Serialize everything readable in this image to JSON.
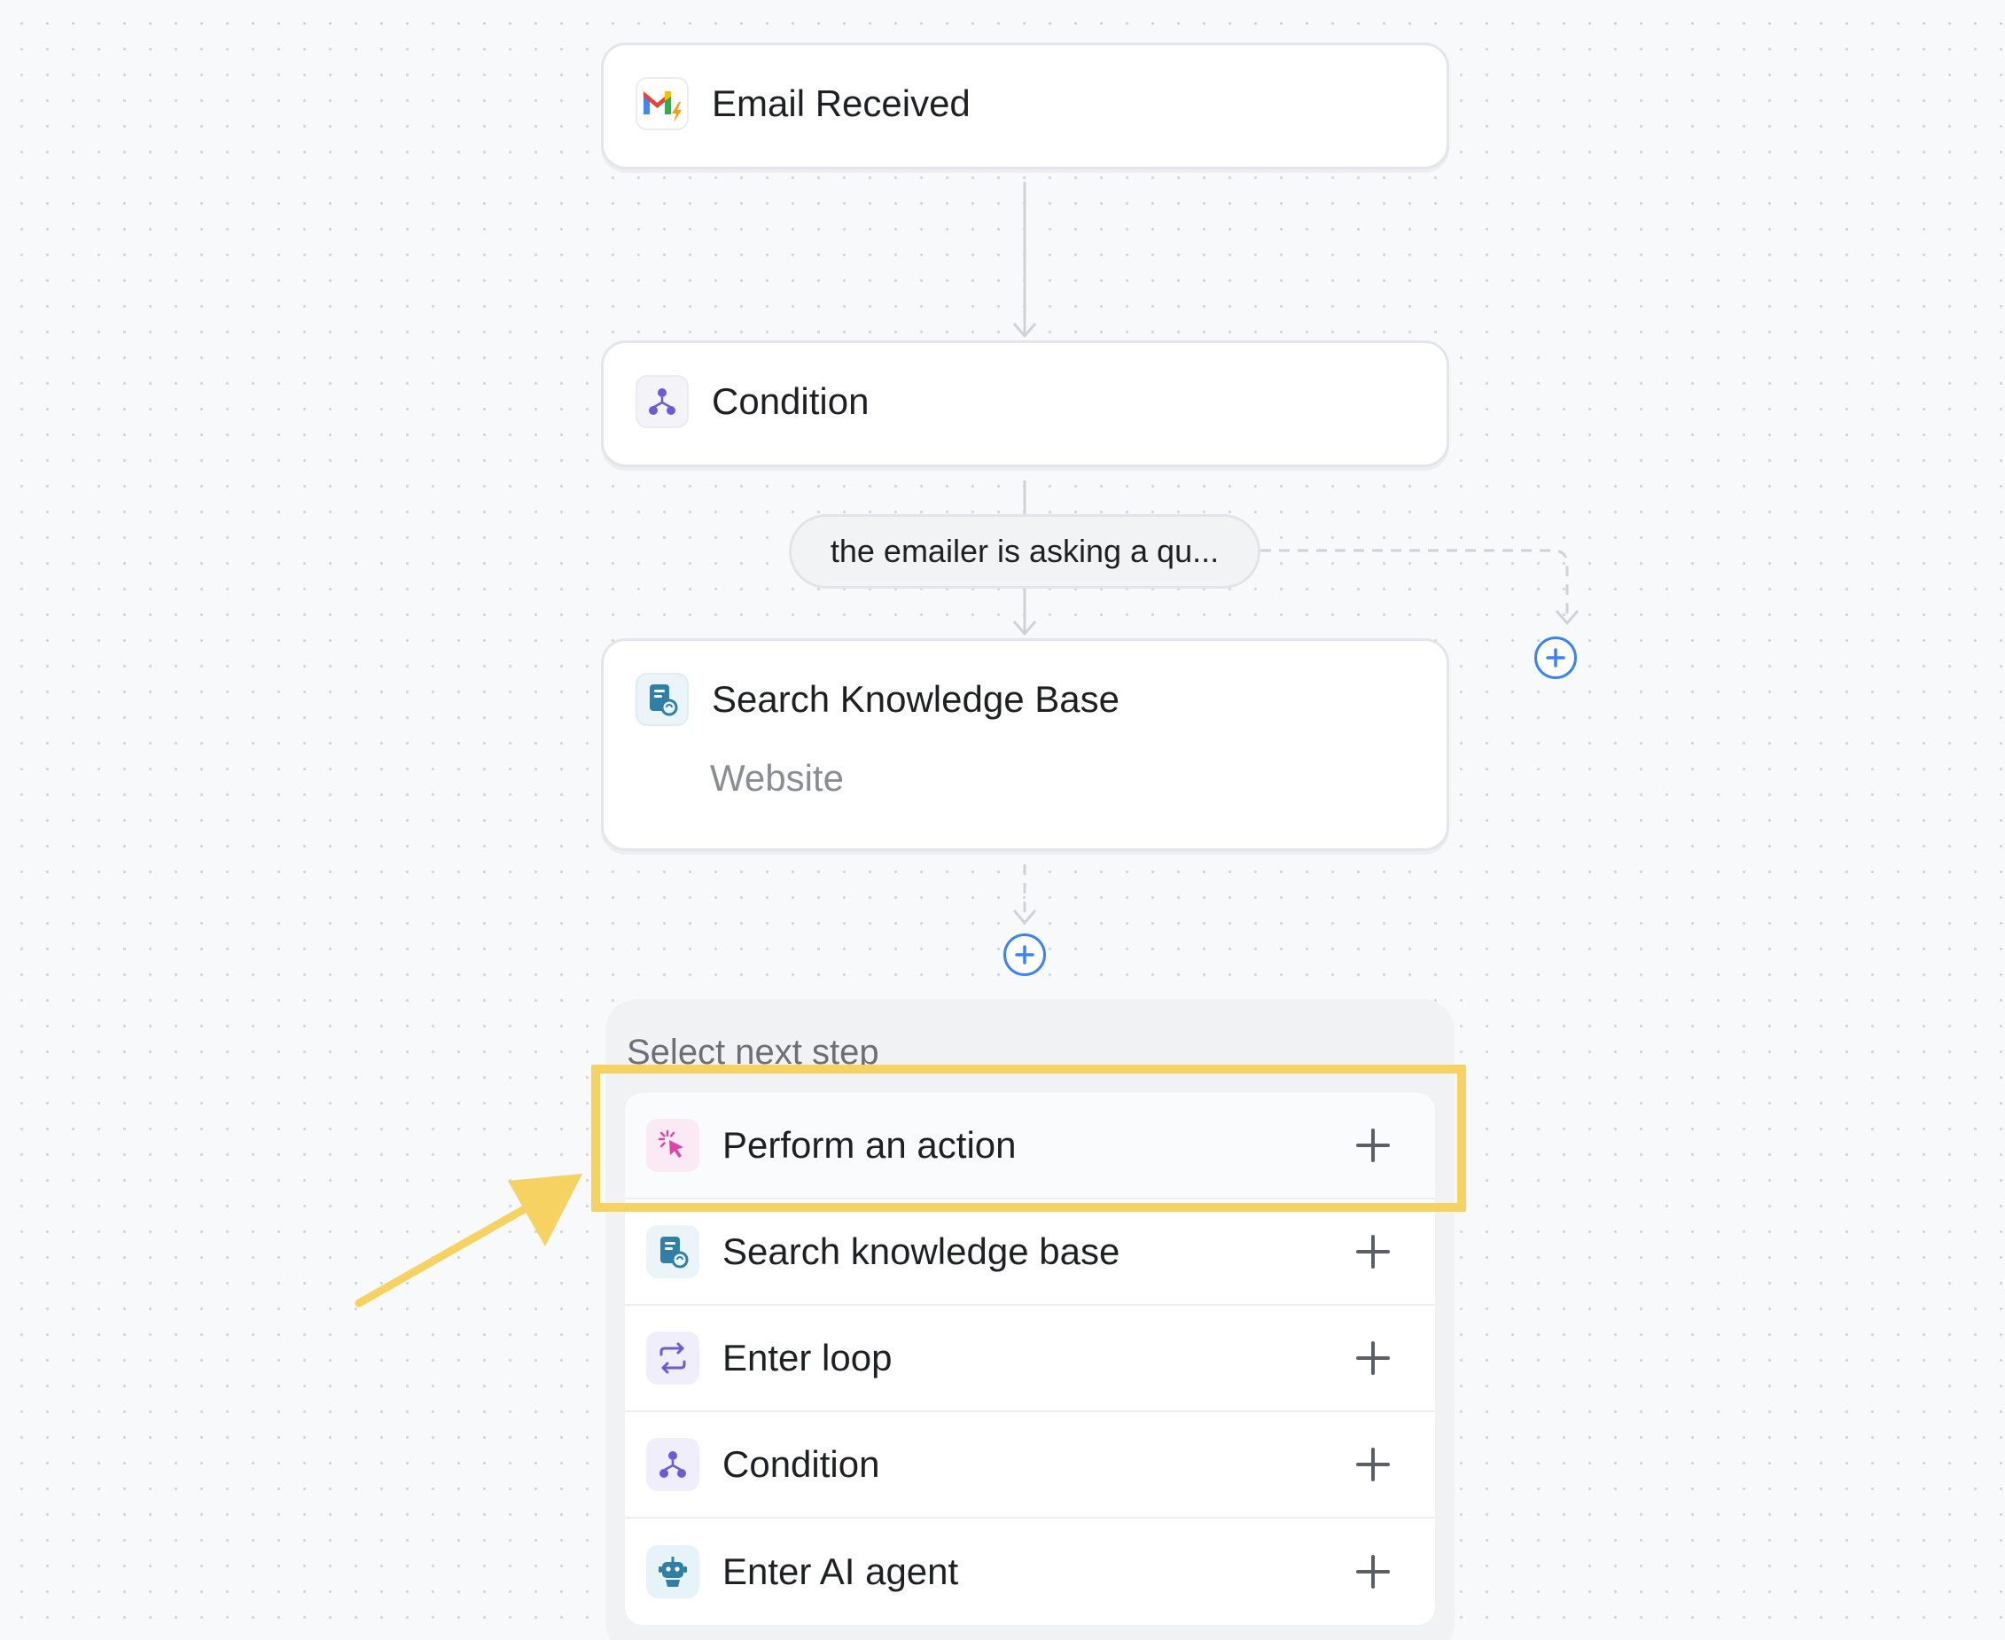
{
  "nodes": [
    {
      "title": "Email Received",
      "icon": "gmail-icon"
    },
    {
      "title": "Condition",
      "icon": "condition-icon"
    },
    {
      "title": "Search Knowledge Base",
      "subtitle": "Website",
      "icon": "knowledge-base-icon"
    }
  ],
  "branch": {
    "label": "the emailer is asking a qu..."
  },
  "next_step": {
    "title": "Select next step",
    "options": [
      {
        "label": "Perform an action",
        "icon": "cursor-click-icon"
      },
      {
        "label": "Search knowledge base",
        "icon": "knowledge-base-icon"
      },
      {
        "label": "Enter loop",
        "icon": "loop-icon"
      },
      {
        "label": "Condition",
        "icon": "condition-icon"
      },
      {
        "label": "Enter AI agent",
        "icon": "robot-icon"
      }
    ]
  },
  "colors": {
    "accent_blue": "#3b82f6",
    "highlight_yellow": "#f6d262",
    "condition_purple": "#6b5bd6",
    "action_pink": "#d946a8",
    "kb_teal": "#2f7fa6"
  }
}
